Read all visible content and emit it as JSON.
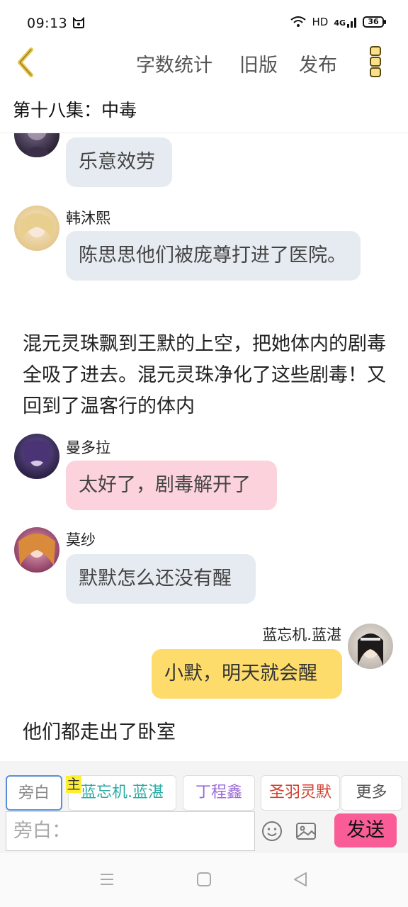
{
  "status_bar": {
    "time": "09:13",
    "network": "HD",
    "signal": "4G",
    "battery": "36"
  },
  "header": {
    "word_count_label": "字数统计",
    "old_version_label": "旧版",
    "publish_label": "发布"
  },
  "chapter_title": "第十八集：中毒",
  "messages": [
    {
      "type": "bubble",
      "text": "乐意效劳"
    },
    {
      "type": "bubble",
      "name": "韩沐熙",
      "text": "陈思思他们被庞尊打进了医院。"
    },
    {
      "type": "narration",
      "text": "混元灵珠飘到王默的上空，把她体内的剧毒全吸了进去。混元灵珠净化了这些剧毒！又回到了温客行的体内"
    },
    {
      "type": "bubble",
      "name": "曼多拉",
      "text": "太好了，剧毒解开了"
    },
    {
      "type": "bubble",
      "name": "莫纱",
      "text": "默默怎么还没有醒"
    },
    {
      "type": "bubble",
      "name": "蓝忘机.蓝湛",
      "text": "小默，明天就会醒"
    },
    {
      "type": "narration",
      "text": "他们都走出了卧室"
    }
  ],
  "toolbar": {
    "chips": [
      "旁白",
      "蓝忘机.蓝湛",
      "丁程鑫",
      "圣羽灵默",
      "更多"
    ],
    "main_tag": "主",
    "input_placeholder": "旁白：",
    "send_label": "发送"
  },
  "colors": {
    "bubble_gray": "#e6ebf1",
    "bubble_pink": "#fcd3dc",
    "bubble_yellow": "#fddc6c",
    "send_button": "#fa5c97",
    "chip_teal": "#2aaba3",
    "chip_purple": "#9b6bd6",
    "chip_red": "#d2402f",
    "back_arrow": "#e7c74a"
  }
}
